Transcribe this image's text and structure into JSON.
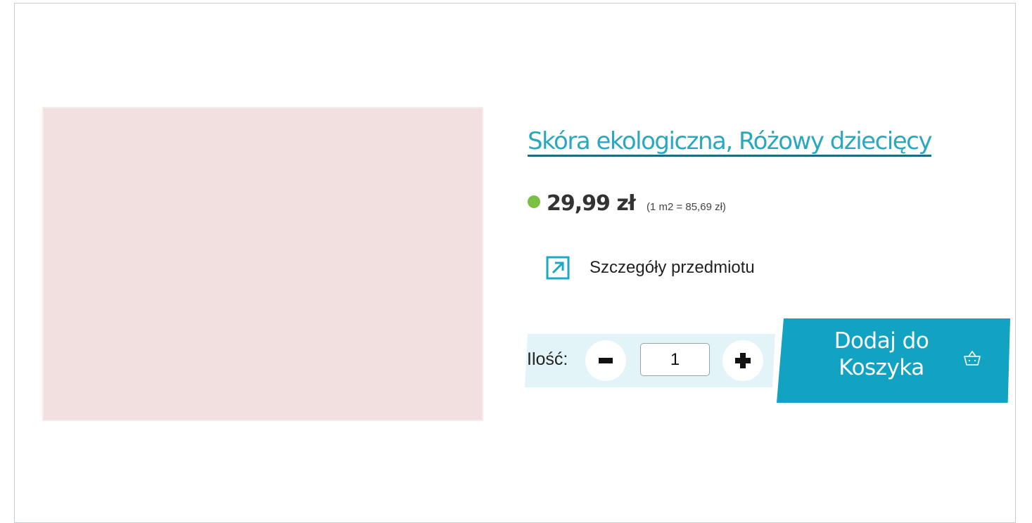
{
  "product": {
    "title": "Skóra ekologiczna, Różowy dziecięcy",
    "image_color": "#f2e0e0",
    "availability_color": "#7cc043",
    "price": "29,99 zł",
    "unit_price": "(1 m2 = 85,69 zł)"
  },
  "details": {
    "label": "Szczegóły przedmiotu",
    "icon": "external-link-arrow-icon",
    "icon_color": "#1aa9c6"
  },
  "quantity": {
    "label": "Ilość:",
    "value": "1",
    "decrement_icon": "minus-icon",
    "increment_icon": "plus-icon"
  },
  "cart": {
    "button_line1": "Dodaj do",
    "button_line2": "Koszyka",
    "icon": "basket-icon",
    "button_color": "#11a3c1"
  }
}
